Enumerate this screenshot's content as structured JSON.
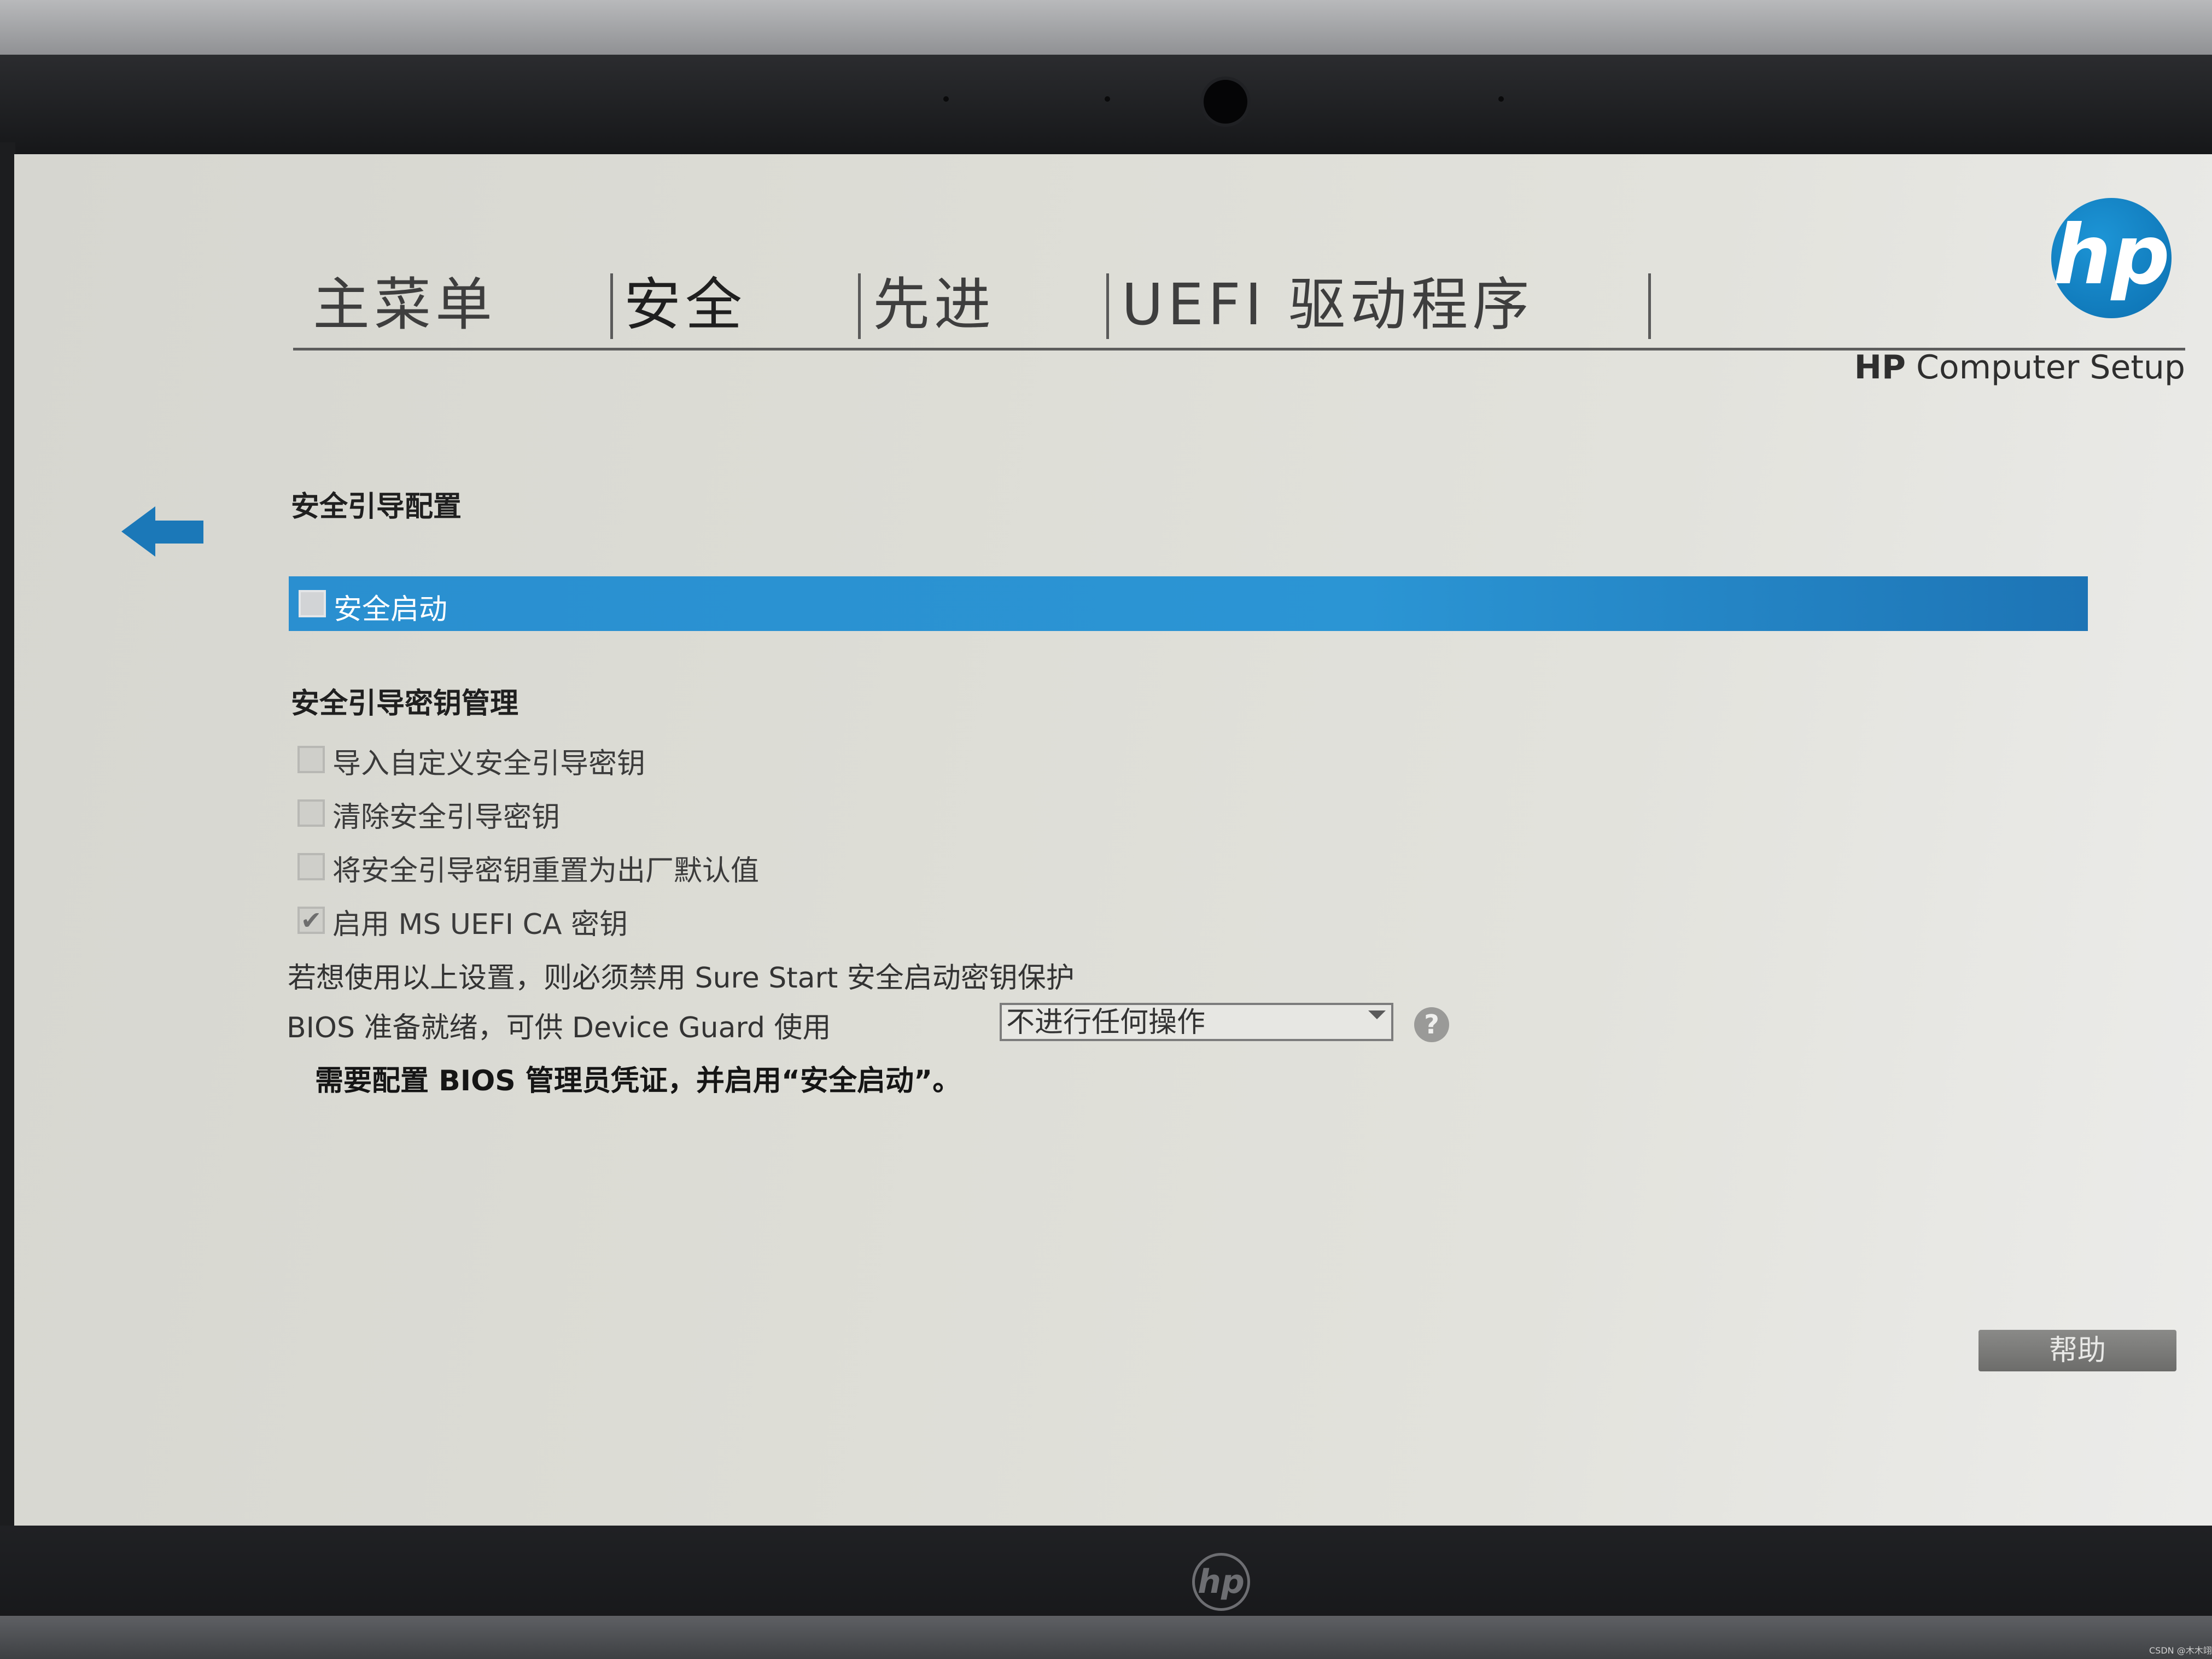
{
  "tabs": [
    {
      "label": "主菜单",
      "active": false
    },
    {
      "label": "安全",
      "active": true
    },
    {
      "label": "先进",
      "active": false
    },
    {
      "label": "UEFI 驱动程序",
      "active": false
    }
  ],
  "brand": {
    "logo_text": "hp",
    "app_title_bold": "HP",
    "app_title_rest": " Computer Setup",
    "accent_color": "#2a8fd0"
  },
  "back": {
    "icon": "back-arrow-icon"
  },
  "secure_boot_config": {
    "title": "安全引导配置",
    "secure_boot": {
      "label": "安全启动",
      "checked": false,
      "selected": true
    }
  },
  "key_management": {
    "title": "安全引导密钥管理",
    "items": [
      {
        "label": "导入自定义安全引导密钥",
        "checked": false
      },
      {
        "label": "清除安全引导密钥",
        "checked": false
      },
      {
        "label": "将安全引导密钥重置为出厂默认值",
        "checked": false
      },
      {
        "label": "启用 MS UEFI CA 密钥",
        "checked": true
      }
    ],
    "note": "若想使用以上设置，则必须禁用 Sure Start 安全启动密钥保护"
  },
  "device_guard": {
    "label": "BIOS 准备就绪，可供 Device Guard 使用",
    "selected_value": "不进行任何操作",
    "help_glyph": "?",
    "warning": "需要配置 BIOS 管理员凭证，并启用“安全启动”。"
  },
  "footer": {
    "help_label": "帮助"
  },
  "watermark": "CSDN @木木翊"
}
